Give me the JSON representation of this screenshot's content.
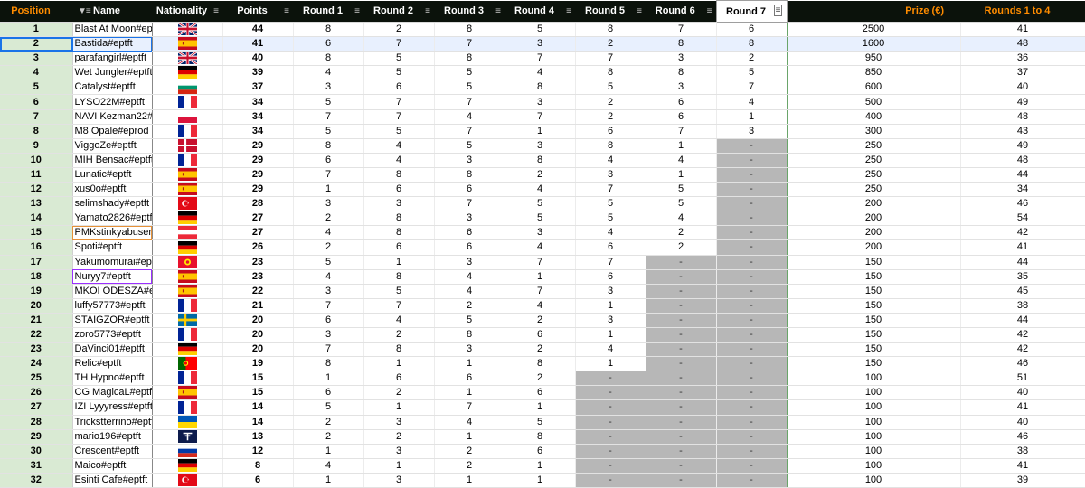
{
  "headers": [
    "Position",
    "Name",
    "Nationality",
    "Points",
    "Round 1",
    "Round 2",
    "Round 3",
    "Round 4",
    "Round 5",
    "Round 6",
    "Round 7",
    "Prize (€)",
    "Rounds 1 to 4"
  ],
  "rows": [
    {
      "pos": "1",
      "name": "Blast At Moon#ept",
      "flag": "gb",
      "pts": "44",
      "r": [
        "8",
        "2",
        "8",
        "5",
        "8",
        "7",
        "6"
      ],
      "prize": "2500",
      "r14": "41"
    },
    {
      "pos": "2",
      "name": "Bastida#eptft",
      "flag": "es",
      "pts": "41",
      "r": [
        "6",
        "7",
        "7",
        "3",
        "2",
        "8",
        "8"
      ],
      "prize": "1600",
      "r14": "48"
    },
    {
      "pos": "3",
      "name": "parafangirl#eptft",
      "flag": "gb",
      "pts": "40",
      "r": [
        "8",
        "5",
        "8",
        "7",
        "7",
        "3",
        "2"
      ],
      "prize": "950",
      "r14": "36"
    },
    {
      "pos": "4",
      "name": "Wet Jungler#eptft",
      "flag": "de",
      "pts": "39",
      "r": [
        "4",
        "5",
        "5",
        "4",
        "8",
        "8",
        "5"
      ],
      "prize": "850",
      "r14": "37"
    },
    {
      "pos": "5",
      "name": "Catalyst#eptft",
      "flag": "bg",
      "pts": "37",
      "r": [
        "3",
        "6",
        "5",
        "8",
        "5",
        "3",
        "7"
      ],
      "prize": "600",
      "r14": "40"
    },
    {
      "pos": "6",
      "name": "LYSO22M#eptft",
      "flag": "fr",
      "pts": "34",
      "r": [
        "5",
        "7",
        "7",
        "3",
        "2",
        "6",
        "4"
      ],
      "prize": "500",
      "r14": "49"
    },
    {
      "pos": "7",
      "name": "NAVI Kezman22#e",
      "flag": "pl",
      "pts": "34",
      "r": [
        "7",
        "7",
        "4",
        "7",
        "2",
        "6",
        "1"
      ],
      "prize": "400",
      "r14": "48"
    },
    {
      "pos": "8",
      "name": "M8 Opale#eprod",
      "flag": "fr",
      "pts": "34",
      "r": [
        "5",
        "5",
        "7",
        "1",
        "6",
        "7",
        "3"
      ],
      "prize": "300",
      "r14": "43"
    },
    {
      "pos": "9",
      "name": "ViggoZe#eptft",
      "flag": "dk",
      "pts": "29",
      "r": [
        "8",
        "4",
        "5",
        "3",
        "8",
        "1",
        "-"
      ],
      "prize": "250",
      "r14": "49"
    },
    {
      "pos": "10",
      "name": "MIH Bensac#eptft",
      "flag": "fr",
      "pts": "29",
      "r": [
        "6",
        "4",
        "3",
        "8",
        "4",
        "4",
        "-"
      ],
      "prize": "250",
      "r14": "48"
    },
    {
      "pos": "11",
      "name": "Lunatic#eptft",
      "flag": "es",
      "pts": "29",
      "r": [
        "7",
        "8",
        "8",
        "2",
        "3",
        "1",
        "-"
      ],
      "prize": "250",
      "r14": "44"
    },
    {
      "pos": "12",
      "name": "xus0o#eptft",
      "flag": "es",
      "pts": "29",
      "r": [
        "1",
        "6",
        "6",
        "4",
        "7",
        "5",
        "-"
      ],
      "prize": "250",
      "r14": "34"
    },
    {
      "pos": "13",
      "name": "selimshady#eptft",
      "flag": "tr",
      "pts": "28",
      "r": [
        "3",
        "3",
        "7",
        "5",
        "5",
        "5",
        "-"
      ],
      "prize": "200",
      "r14": "46"
    },
    {
      "pos": "14",
      "name": "Yamato2826#eptft",
      "flag": "de",
      "pts": "27",
      "r": [
        "2",
        "8",
        "3",
        "5",
        "5",
        "4",
        "-"
      ],
      "prize": "200",
      "r14": "54"
    },
    {
      "pos": "15",
      "name": "PMKstinkyabuser#",
      "flag": "at",
      "pts": "27",
      "r": [
        "4",
        "8",
        "6",
        "3",
        "4",
        "2",
        "-"
      ],
      "prize": "200",
      "r14": "42"
    },
    {
      "pos": "16",
      "name": "Spoti#eptft",
      "flag": "de",
      "pts": "26",
      "r": [
        "2",
        "6",
        "6",
        "4",
        "6",
        "2",
        "-"
      ],
      "prize": "200",
      "r14": "41"
    },
    {
      "pos": "17",
      "name": "Yakumomurai#ept",
      "flag": "kg",
      "pts": "23",
      "r": [
        "5",
        "1",
        "3",
        "7",
        "7",
        "-",
        "-"
      ],
      "prize": "150",
      "r14": "44"
    },
    {
      "pos": "18",
      "name": "Nuryy7#eptft",
      "flag": "es",
      "pts": "23",
      "r": [
        "4",
        "8",
        "4",
        "1",
        "6",
        "-",
        "-"
      ],
      "prize": "150",
      "r14": "35"
    },
    {
      "pos": "19",
      "name": "MKOI ODESZA#e",
      "flag": "es",
      "pts": "22",
      "r": [
        "3",
        "5",
        "4",
        "7",
        "3",
        "-",
        "-"
      ],
      "prize": "150",
      "r14": "45"
    },
    {
      "pos": "20",
      "name": "luffy57773#eptft",
      "flag": "fr",
      "pts": "21",
      "r": [
        "7",
        "7",
        "2",
        "4",
        "1",
        "-",
        "-"
      ],
      "prize": "150",
      "r14": "38"
    },
    {
      "pos": "21",
      "name": "STAIGZOR#eptft",
      "flag": "se",
      "pts": "20",
      "r": [
        "6",
        "4",
        "5",
        "2",
        "3",
        "-",
        "-"
      ],
      "prize": "150",
      "r14": "44"
    },
    {
      "pos": "22",
      "name": "zoro5773#eptft",
      "flag": "fr",
      "pts": "20",
      "r": [
        "3",
        "2",
        "8",
        "6",
        "1",
        "-",
        "-"
      ],
      "prize": "150",
      "r14": "42"
    },
    {
      "pos": "23",
      "name": "DaVinci01#eptft",
      "flag": "de",
      "pts": "20",
      "r": [
        "7",
        "8",
        "3",
        "2",
        "4",
        "-",
        "-"
      ],
      "prize": "150",
      "r14": "42"
    },
    {
      "pos": "24",
      "name": "Relic#eptft",
      "flag": "pt",
      "pts": "19",
      "r": [
        "8",
        "1",
        "1",
        "8",
        "1",
        "-",
        "-"
      ],
      "prize": "150",
      "r14": "46"
    },
    {
      "pos": "25",
      "name": "TH Hypno#eptft",
      "flag": "fr",
      "pts": "15",
      "r": [
        "1",
        "6",
        "6",
        "2",
        "-",
        "-",
        "-"
      ],
      "prize": "100",
      "r14": "51"
    },
    {
      "pos": "26",
      "name": "CG MagicaL#eptft",
      "flag": "es",
      "pts": "15",
      "r": [
        "6",
        "2",
        "1",
        "6",
        "-",
        "-",
        "-"
      ],
      "prize": "100",
      "r14": "40"
    },
    {
      "pos": "27",
      "name": "IZI Lyyyress#eptft",
      "flag": "fr",
      "pts": "14",
      "r": [
        "5",
        "1",
        "7",
        "1",
        "-",
        "-",
        "-"
      ],
      "prize": "100",
      "r14": "41"
    },
    {
      "pos": "28",
      "name": "Trickstterrino#eptft",
      "flag": "ua",
      "pts": "14",
      "r": [
        "2",
        "3",
        "4",
        "5",
        "-",
        "-",
        "-"
      ],
      "prize": "100",
      "r14": "40"
    },
    {
      "pos": "29",
      "name": "mario196#eptft",
      "flag": "tf",
      "pts": "13",
      "r": [
        "2",
        "2",
        "1",
        "8",
        "-",
        "-",
        "-"
      ],
      "prize": "100",
      "r14": "46"
    },
    {
      "pos": "30",
      "name": "Crescent#eptft",
      "flag": "ru",
      "pts": "12",
      "r": [
        "1",
        "3",
        "2",
        "6",
        "-",
        "-",
        "-"
      ],
      "prize": "100",
      "r14": "38"
    },
    {
      "pos": "31",
      "name": "Maico#eptft",
      "flag": "de",
      "pts": "8",
      "r": [
        "4",
        "1",
        "2",
        "1",
        "-",
        "-",
        "-"
      ],
      "prize": "100",
      "r14": "41"
    },
    {
      "pos": "32",
      "name": "Esinti Cafe#eptft",
      "flag": "tr",
      "pts": "6",
      "r": [
        "1",
        "3",
        "1",
        "1",
        "-",
        "-",
        "-"
      ],
      "prize": "100",
      "r14": "39"
    }
  ],
  "colors": {
    "header_bg": "#0b120b",
    "position_bg": "#d9ead3",
    "eliminated_bg": "#b7b7b7",
    "accent_orange": "#ff8c00",
    "selection": "#1a73e8"
  }
}
